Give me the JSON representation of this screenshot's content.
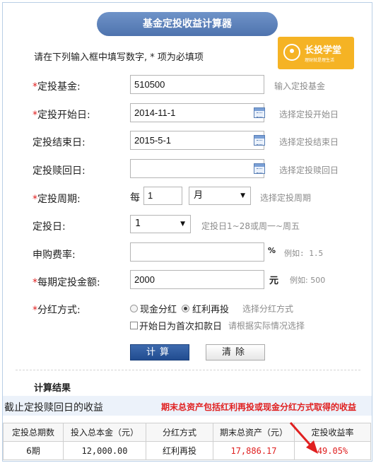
{
  "title": "基金定投收益计算器",
  "hint": "请在下列输入框中填写数字, * 项为必填项",
  "brand": {
    "name": "长投学堂",
    "tagline": "理财就是理生活",
    "color": "#f5b324"
  },
  "form": {
    "fund": {
      "label": "定投基金:",
      "value": "510500",
      "hint": "输入定投基金",
      "required": true
    },
    "start_date": {
      "label": "定投开始日:",
      "value": "2014-11-1",
      "hint": "选择定投开始日",
      "required": true
    },
    "end_date": {
      "label": "定投结束日:",
      "value": "2015-5-1",
      "hint": "选择定投结束日",
      "required": false
    },
    "redeem_date": {
      "label": "定投赎回日:",
      "value": "",
      "hint": "选择定投赎回日",
      "required": false
    },
    "period": {
      "label": "定投周期:",
      "prefix": "每",
      "value": "1",
      "unit": "月",
      "hint": "选择定投周期",
      "required": true
    },
    "day": {
      "label": "定投日:",
      "value": "1",
      "hint": "定投日1~28或周一~周五",
      "required": false
    },
    "fee": {
      "label": "申购费率:",
      "value": "",
      "unit": "%",
      "hint": "例如: 1.5",
      "required": false
    },
    "amount": {
      "label": "每期定投金额:",
      "value": "2000",
      "unit": "元",
      "hint": "例如: 500",
      "required": true
    },
    "dividend": {
      "label": "分红方式:",
      "option_cash": "现金分红",
      "option_reinvest": "红利再投",
      "selected": "红利再投",
      "hint": "选择分红方式",
      "required": true
    },
    "first_debit": {
      "label": "开始日为首次扣款日",
      "checked": false,
      "hint": "请根据实际情况选择"
    }
  },
  "buttons": {
    "calc": "计算",
    "clear": "清除"
  },
  "result": {
    "section_title": "计算结果",
    "band_left": "截止定投赎回日的收益",
    "band_right": "期末总资产包括红利再投或现金分红方式取得的收益",
    "columns": [
      "定投总期数",
      "投入总本金（元）",
      "分红方式",
      "期末总资产（元）",
      "定投收益率"
    ],
    "row": [
      "6期",
      "12,000.00",
      "红利再投",
      "17,886.17",
      "49.05%"
    ]
  },
  "colors": {
    "accent_red": "#e02020",
    "title_blue": "#4e73ae"
  }
}
